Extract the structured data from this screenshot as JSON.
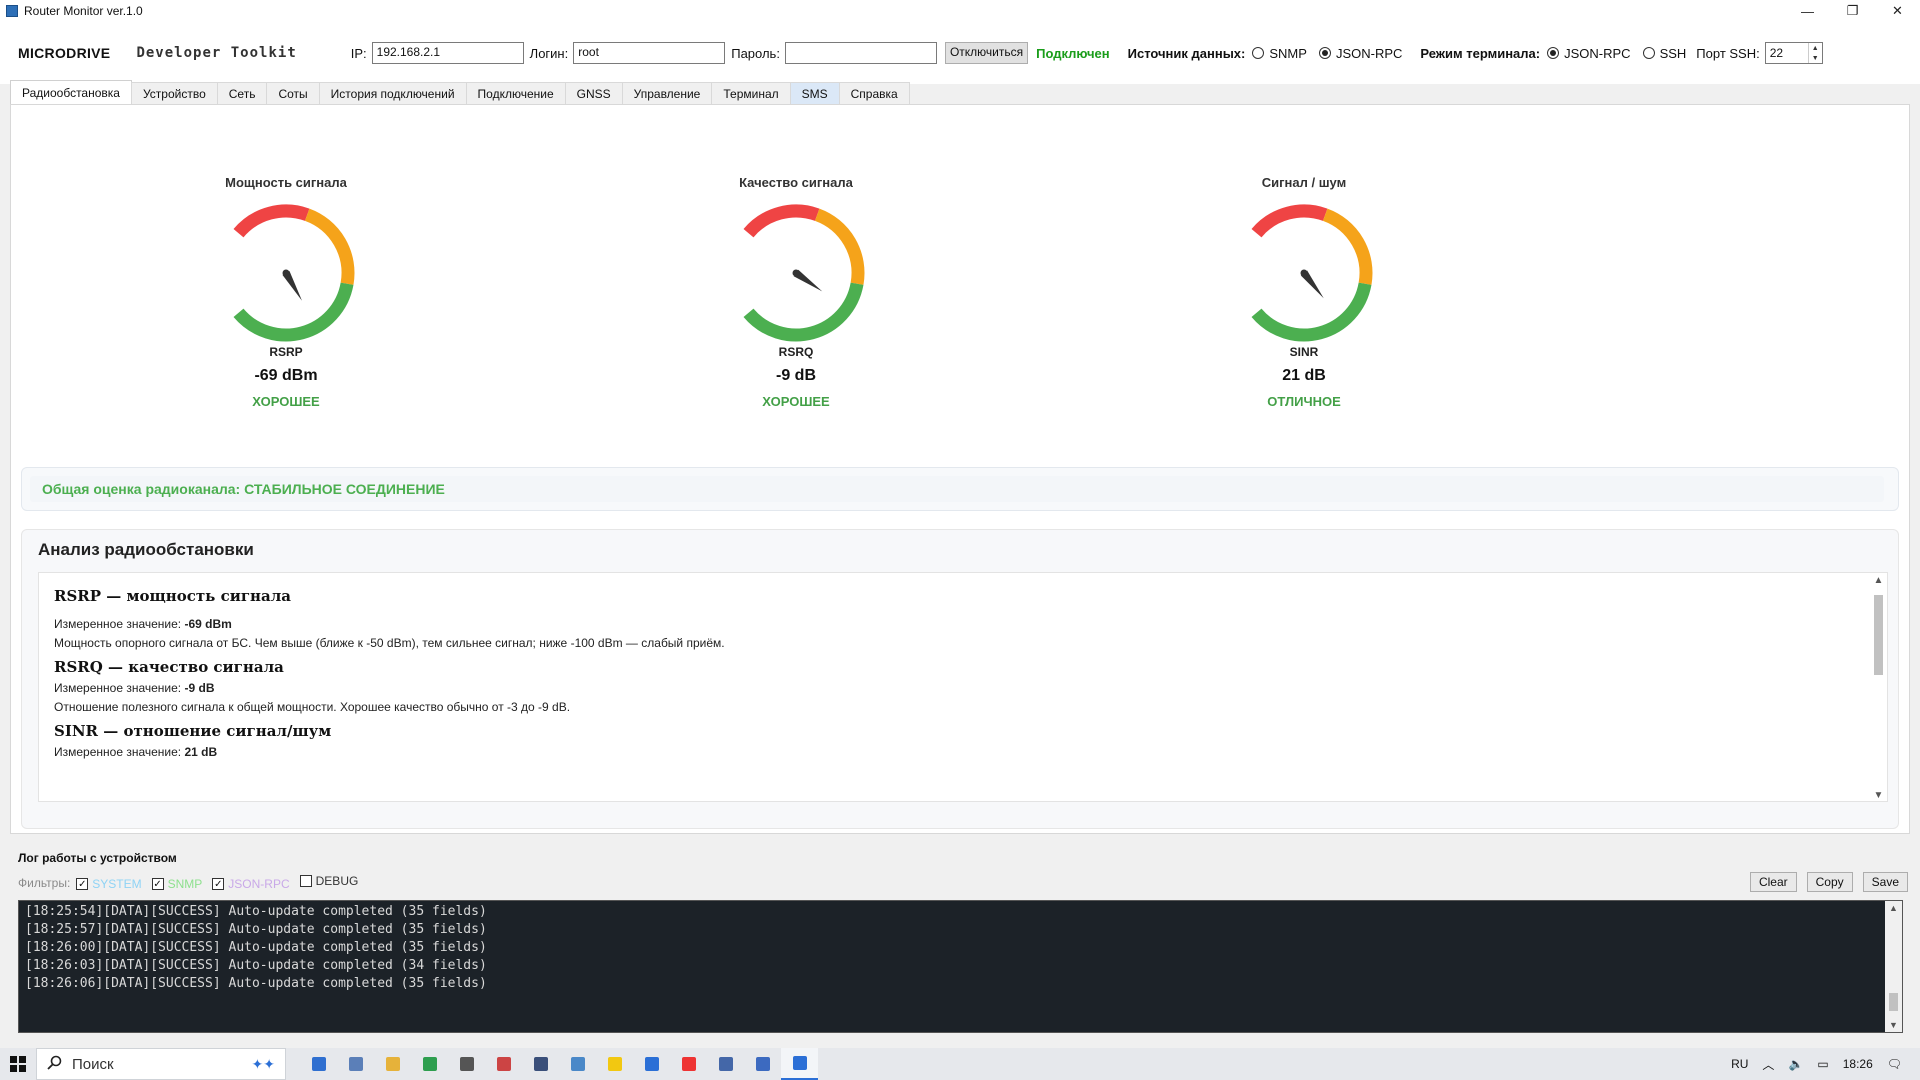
{
  "window": {
    "title": "Router Monitor ver.1.0",
    "min": "—",
    "max": "❐",
    "close": "✕"
  },
  "toolbar": {
    "brand": "MICRODRIVE",
    "brand_sub": "Developer Toolkit",
    "ip_label": "IP:",
    "ip_value": "192.168.2.1",
    "login_label": "Логин:",
    "login_value": "root",
    "password_label": "Пароль:",
    "password_value": "",
    "disconnect_label": "Отключиться",
    "status": "Подключен",
    "datasource_label": "Источник данных:",
    "datasource_options": [
      "SNMP",
      "JSON-RPC"
    ],
    "datasource_selected": "JSON-RPC",
    "terminal_label": "Режим терминала:",
    "terminal_options": [
      "JSON-RPC",
      "SSH"
    ],
    "terminal_selected": "JSON-RPC",
    "ssh_port_label": "Порт SSH:",
    "ssh_port_value": "22"
  },
  "tabs": [
    {
      "label": "Радиообстановка",
      "active": true
    },
    {
      "label": "Устройство"
    },
    {
      "label": "Сеть"
    },
    {
      "label": "Соты"
    },
    {
      "label": "История подключений"
    },
    {
      "label": "Подключение"
    },
    {
      "label": "GNSS"
    },
    {
      "label": "Управление"
    },
    {
      "label": "Терминал"
    },
    {
      "label": "SMS",
      "highlight": true
    },
    {
      "label": "Справка"
    }
  ],
  "gauges": [
    {
      "title": "Мощность сигнала",
      "metric": "RSRP",
      "value": "-69 dBm",
      "rating": "ХОРОШЕЕ",
      "needle_deg": -30
    },
    {
      "title": "Качество сигнала",
      "metric": "RSRQ",
      "value": "-9 dB",
      "rating": "ХОРОШЕЕ",
      "needle_deg": -55
    },
    {
      "title": "Сигнал / шум",
      "metric": "SINR",
      "value": "21 dB",
      "rating": "ОТЛИЧНОЕ",
      "needle_deg": -38
    }
  ],
  "colors": {
    "red": "#ef4444",
    "orange": "#f5a31a",
    "green": "#4caf50",
    "status_ok": "#1a9d1a"
  },
  "overall": {
    "text": "Общая оценка радиоканала: СТАБИЛЬНОЕ СОЕДИНЕНИЕ"
  },
  "analysis": {
    "title": "Анализ радиообстановки",
    "sections": [
      {
        "heading": "RSRP — мощность сигнала",
        "measured_label": "Измеренное значение:",
        "measured_value": "-69 dBm",
        "desc": "Мощность опорного сигнала от БС. Чем выше (ближе к -50 dBm), тем сильнее сигнал; ниже -100 dBm — слабый приём."
      },
      {
        "heading": "RSRQ — качество сигнала",
        "measured_label": "Измеренное значение:",
        "measured_value": "-9 dB",
        "desc": "Отношение полезного сигнала к общей мощности. Хорошее качество обычно от -3 до -9 dB."
      },
      {
        "heading": "SINR — отношение сигнал/шум",
        "measured_label": "Измеренное значение:",
        "measured_value": "21 dB"
      }
    ]
  },
  "log": {
    "title": "Лог работы с устройством",
    "filters_label": "Фильтры:",
    "filters": [
      {
        "label": "SYSTEM",
        "checked": true,
        "color": "#8fd3f5"
      },
      {
        "label": "SNMP",
        "checked": true,
        "color": "#8ee08e"
      },
      {
        "label": "JSON-RPC",
        "checked": true,
        "color": "#c9a9e8"
      },
      {
        "label": "DEBUG",
        "checked": false,
        "color": "#333333"
      }
    ],
    "buttons": {
      "clear": "Clear",
      "copy": "Copy",
      "save": "Save"
    },
    "lines": [
      "[18:25:54][DATA][SUCCESS] Auto-update completed (35 fields)",
      "[18:25:57][DATA][SUCCESS] Auto-update completed (35 fields)",
      "[18:26:00][DATA][SUCCESS] Auto-update completed (35 fields)",
      "[18:26:03][DATA][SUCCESS] Auto-update completed (34 fields)",
      "[18:26:06][DATA][SUCCESS] Auto-update completed (35 fields)"
    ]
  },
  "taskbar": {
    "search_label": "Поиск",
    "lang": "RU",
    "time": "18:26",
    "apps": [
      "notepad-icon",
      "document-icon",
      "file-explorer-icon",
      "spreadsheet-icon",
      "calculator-icon",
      "video-icon",
      "floppy-icon",
      "image-icon",
      "sticky-notes-icon",
      "todo-icon",
      "yandex-browser-icon",
      "remote-desktop-icon",
      "text-file-icon",
      "router-monitor-icon"
    ]
  }
}
